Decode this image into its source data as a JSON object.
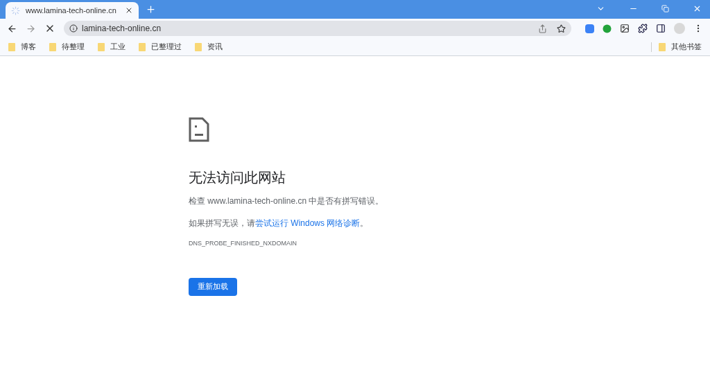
{
  "tab": {
    "title": "www.lamina-tech-online.cn",
    "selected": true
  },
  "address_bar": {
    "value": "lamina-tech-online.cn"
  },
  "bookmarks": [
    {
      "label": "博客"
    },
    {
      "label": "待整理"
    },
    {
      "label": "工业"
    },
    {
      "label": "已整理过"
    },
    {
      "label": "资讯"
    }
  ],
  "other_bookmarks": {
    "label": "其他书签"
  },
  "error": {
    "title": "无法访问此网站",
    "check_text": "检查 www.lamina-tech-online.cn 中是否有拼写错误。",
    "suggestion_prefix": "如果拼写无误，请",
    "suggestion_link": "尝试运行 Windows 网络诊断",
    "suggestion_suffix": "。",
    "code": "DNS_PROBE_FINISHED_NXDOMAIN",
    "button": "重新加载"
  }
}
